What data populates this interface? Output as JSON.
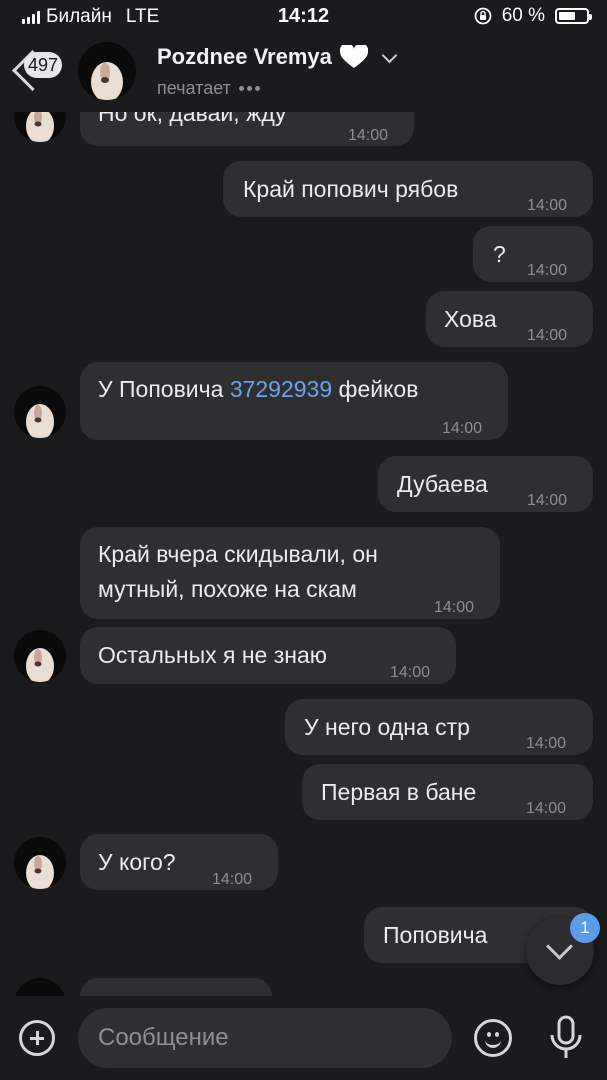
{
  "status_bar": {
    "carrier": "Билайн",
    "network": "LTE",
    "time": "14:12",
    "battery_percent": "60 %",
    "battery_level": 0.6
  },
  "header": {
    "unread_count": "497",
    "contact_name": "Pozdnee Vremya",
    "status": "печатает",
    "heart_icon": "heart-icon",
    "accent_color": "#6ea2e8"
  },
  "messages": [
    {
      "side": "in",
      "text": "Но ок, давай, жду",
      "time": "14:00"
    },
    {
      "side": "out",
      "text": "Край попович рябов",
      "time": "14:00"
    },
    {
      "side": "out",
      "text": "?",
      "time": "14:00"
    },
    {
      "side": "out",
      "text": "Хова",
      "time": "14:00"
    },
    {
      "side": "in",
      "text_before": "У Поповича ",
      "link": "37292939",
      "text_after": " фейков",
      "time": "14:00"
    },
    {
      "side": "out",
      "text": "Дубаева",
      "time": "14:00"
    },
    {
      "side": "in",
      "line1": "Край вчера скидывали, он",
      "line2": "мутный, похоже на скам",
      "time": "14:00"
    },
    {
      "side": "in",
      "text": "Остальных я не знаю",
      "time": "14:00"
    },
    {
      "side": "out",
      "text": "У него одна стр",
      "time": "14:00"
    },
    {
      "side": "out",
      "text": "Первая в бане",
      "time": "14:00"
    },
    {
      "side": "in",
      "text": "У кого?",
      "time": "14:00"
    },
    {
      "side": "out",
      "text": "Поповича",
      "time": ""
    }
  ],
  "scroll_down": {
    "unread": "1"
  },
  "composer": {
    "placeholder": "Сообщение"
  }
}
